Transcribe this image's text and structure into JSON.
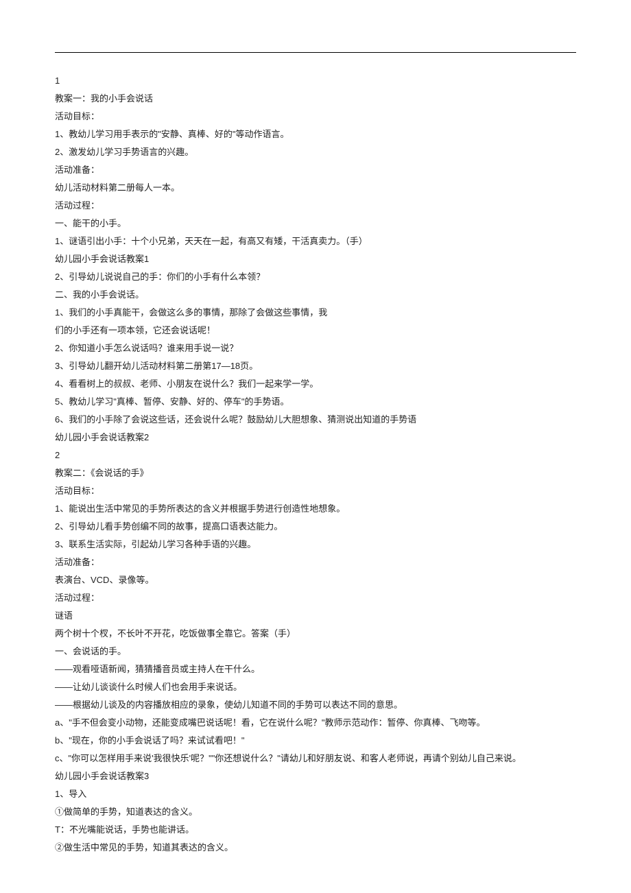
{
  "lines": [
    "1",
    "教案一：我的小手会说话",
    "活动目标：",
    "1、教幼儿学习用手表示的\"安静、真棒、好的\"等动作语言。",
    "2、激发幼儿学习手势语言的兴趣。",
    "活动准备：",
    "幼儿活动材料第二册每人一本。",
    "活动过程：",
    "一、能干的小手。",
    "1、谜语引出小手：十个小兄弟，天天在一起，有高又有矮，干活真卖力。（手）",
    "幼儿园小手会说话教案1",
    "2、引导幼儿说说自己的手：你们的小手有什么本领？",
    "二、我的小手会说话。",
    "1、我们的小手真能干，会做这么多的事情，那除了会做这些事情，我",
    "们的小手还有一项本领，它还会说话呢！",
    "2、你知道小手怎么说话吗？谁来用手说一说？",
    "3、引导幼儿翻开幼儿活动材料第二册第17—18页。",
    "4、看看树上的叔叔、老师、小朋友在说什么？我们一起来学一学。",
    "5、教幼儿学习\"真棒、暂停、安静、好的、停车\"的手势语。",
    "6、我们的小手除了会说这些话，还会说什么呢？鼓励幼儿大胆想象、猜测说出知道的手势语",
    "幼儿园小手会说话教案2",
    "2",
    "教案二：《会说话的手》",
    "活动目标：",
    "1、能说出生活中常见的手势所表达的含义并根据手势进行创造性地想象。",
    "2、引导幼儿看手势创编不同的故事，提高口语表达能力。",
    "3、联系生活实际，引起幼儿学习各种手语的兴趣。",
    "活动准备：",
    "表演台、VCD、录像等。",
    "活动过程：",
    "谜语",
    "两个树十个杈，不长叶不开花，吃饭做事全靠它。答案（手）",
    "一、会说话的手。",
    "——观看哑语新闻，猜猜播音员或主持人在干什么。",
    "——让幼儿谈谈什么时候人们也会用手来说话。",
    "——根据幼儿谈及的内容播放相应的录象，使幼儿知道不同的手势可以表达不同的意思。",
    "a、\"手不但会变小动物，还能变成嘴巴说话呢！看，它在说什么呢？\"教师示范动作：暂停、你真棒、飞吻等。",
    "b、\"现在，你的小手会说话了吗？来试试看吧！\"",
    "c、\"你可以怎样用手来说'我很快乐'呢？\"\"你还想说什么？\"请幼儿和好朋友说、和客人老师说，再请个别幼儿自己来说。",
    "幼儿园小手会说话教案3",
    "1、导入",
    "①做简单的手势，知道表达的含义。",
    "T：不光嘴能说话，手势也能讲话。",
    "②做生活中常见的手势，知道其表达的含义。"
  ]
}
